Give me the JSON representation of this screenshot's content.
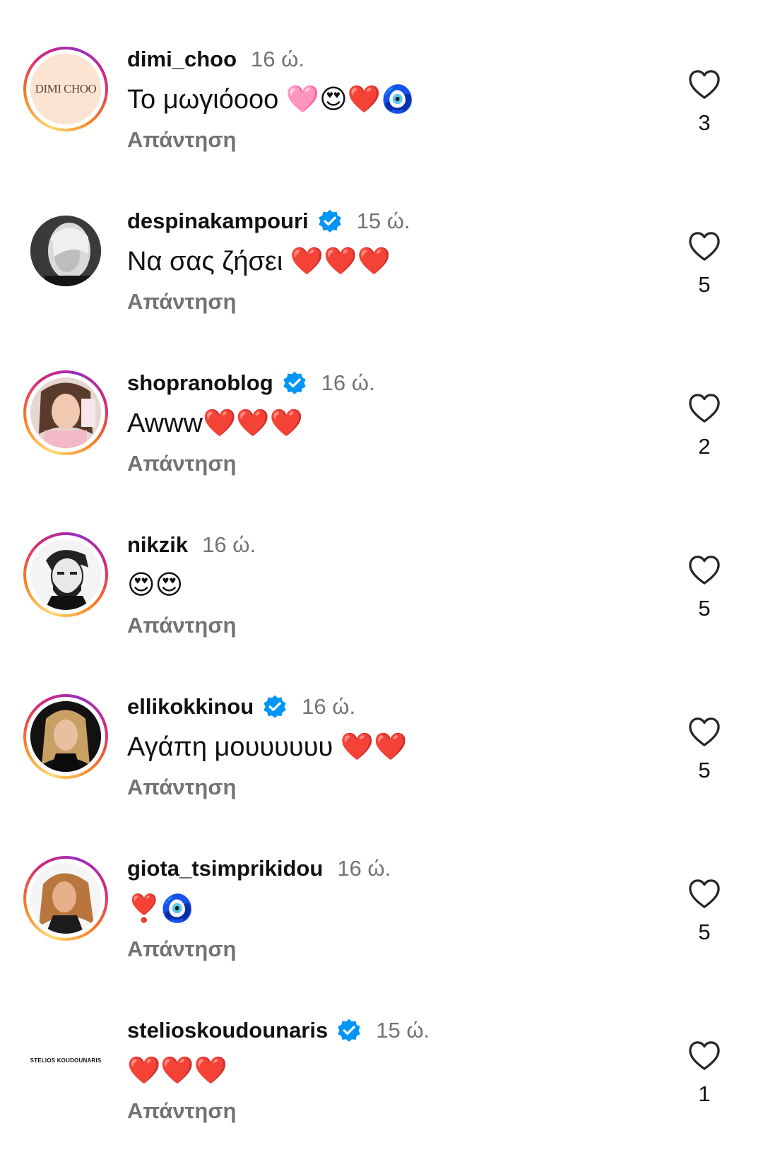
{
  "ui": {
    "reply_label": "Απάντηση"
  },
  "comments": [
    {
      "username": "dimi_choo",
      "verified": false,
      "time": "16 ώ.",
      "text": "Το μωγιόοοο 🩷😍❤️🧿",
      "likes": "3",
      "avatar_text": "DIMI CHOO",
      "story_ring": true
    },
    {
      "username": "despinakampouri",
      "verified": true,
      "time": "15 ώ.",
      "text": "Να σας ζήσει ❤️❤️❤️",
      "likes": "5",
      "story_ring": false
    },
    {
      "username": "shopranoblog",
      "verified": true,
      "time": "16 ώ.",
      "text": "Awww❤️❤️❤️",
      "likes": "2",
      "story_ring": true
    },
    {
      "username": "nikzik",
      "verified": false,
      "time": "16 ώ.",
      "text": "😍😍",
      "likes": "5",
      "story_ring": true
    },
    {
      "username": "ellikokkinou",
      "verified": true,
      "time": "16 ώ.",
      "text": "Αγάπη μουυυυυυ ❤️❤️",
      "likes": "5",
      "story_ring": true
    },
    {
      "username": "giota_tsimprikidou",
      "verified": false,
      "time": "16 ώ.",
      "text": "❣️🧿",
      "likes": "5",
      "story_ring": true
    },
    {
      "username": "stelioskoudounaris",
      "verified": true,
      "time": "15 ώ.",
      "text": "❤️❤️❤️",
      "likes": "1",
      "avatar_text": "STELIOS   KOUDOUNARIS",
      "story_ring": false
    }
  ],
  "colors": {
    "text": "#111111",
    "secondary": "#737373",
    "verified_badge": "#0095f6"
  }
}
